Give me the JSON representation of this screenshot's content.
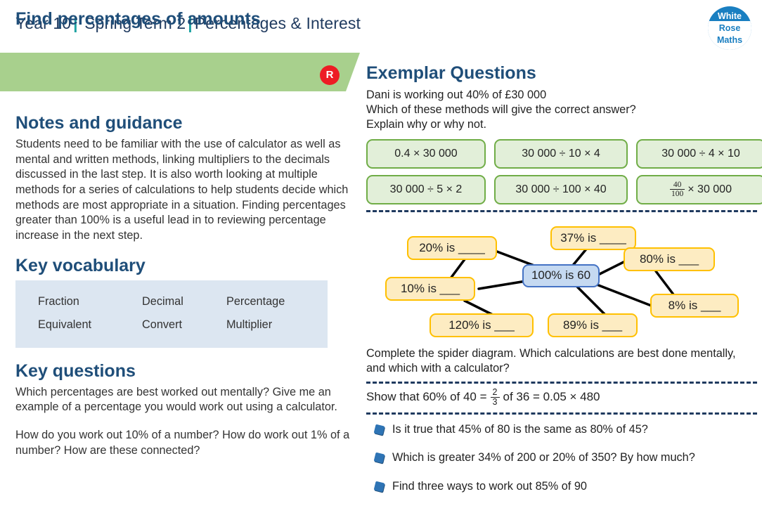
{
  "header": {
    "year": "Year 10",
    "term": "Spring Term",
    "term_number": "2",
    "topic": "Percentages & Interest",
    "separator": "|"
  },
  "logo": {
    "line1": "White",
    "line2": "Rose",
    "line3": "Maths"
  },
  "banner": {
    "title": "Find percentages of amounts",
    "badge": "R"
  },
  "notes": {
    "heading": "Notes and guidance",
    "body": "Students need to be familiar with the use of calculator as well as mental and written methods, linking multipliers to the decimals discussed in the last step.  It is also worth looking at multiple methods for a series of calculations to help students decide which methods are most appropriate in a situation.  Finding percentages greater than 100% is a useful lead in to reviewing percentage increase in the next step."
  },
  "vocabulary": {
    "heading": "Key vocabulary",
    "rows": [
      [
        "Fraction",
        "Decimal",
        "Percentage"
      ],
      [
        "Equivalent",
        "Convert",
        "Multiplier"
      ]
    ]
  },
  "key_questions": {
    "heading": "Key questions",
    "paragraphs": [
      "Which percentages are best worked out mentally?  Give me an example of a percentage you would work out using a calculator.",
      "How do you work out 10% of a number? How do work out 1% of a number?  How are these connected?"
    ]
  },
  "exemplar": {
    "heading": "Exemplar Questions",
    "intro_line1": "Dani is working out 40% of £30 000",
    "intro_line2": "Which of these methods will give the correct answer?",
    "intro_line3": "Explain why or why not.",
    "methods": [
      {
        "text": "0.4 × 30 000",
        "fraction": null
      },
      {
        "text": "30 000 ÷ 10 × 4",
        "fraction": null
      },
      {
        "text": "30 000 ÷ 4 × 10",
        "fraction": null
      },
      {
        "text": "30 000 ÷ 5 × 2",
        "fraction": null
      },
      {
        "text": "30 000 ÷ 100 × 40",
        "fraction": null
      },
      {
        "text": "× 30 000",
        "fraction": {
          "numerator": "40",
          "denominator": "100"
        }
      }
    ],
    "spider": {
      "center": "100% is 60",
      "nodes": [
        "20% is ____",
        "37% is ____",
        "80% is ___",
        "10% is ___",
        "8% is ___",
        "120% is ___",
        "89% is ___"
      ]
    },
    "spider_caption": "Complete the spider diagram.  Which calculations are best done mentally, and which with a calculator?",
    "show_that": {
      "prefix": "Show that 60% of 40 =",
      "fraction": {
        "numerator": "2",
        "denominator": "3"
      },
      "suffix": "of 36 = 0.05 × 480"
    },
    "bullets": [
      "Is it true that 45% of 80 is the same as 80% of 45?",
      "Which is greater 34% of 200 or 20% of 350?  By how much?",
      "Find three ways to work out 85% of 90"
    ]
  },
  "colors": {
    "banner_green": "#a8d08d",
    "heading_blue": "#1f4e79",
    "teal_separator": "#1fa3a3",
    "badge_red": "#ed1c24",
    "method_fill": "#e2efd9",
    "method_border": "#70ad47",
    "node_fill": "#fdecc2",
    "node_border": "#ffc000",
    "center_fill": "#c5d9f1",
    "center_border": "#4472c4",
    "vocab_fill": "#dce6f1",
    "logo_blue": "#1a7fc1"
  }
}
